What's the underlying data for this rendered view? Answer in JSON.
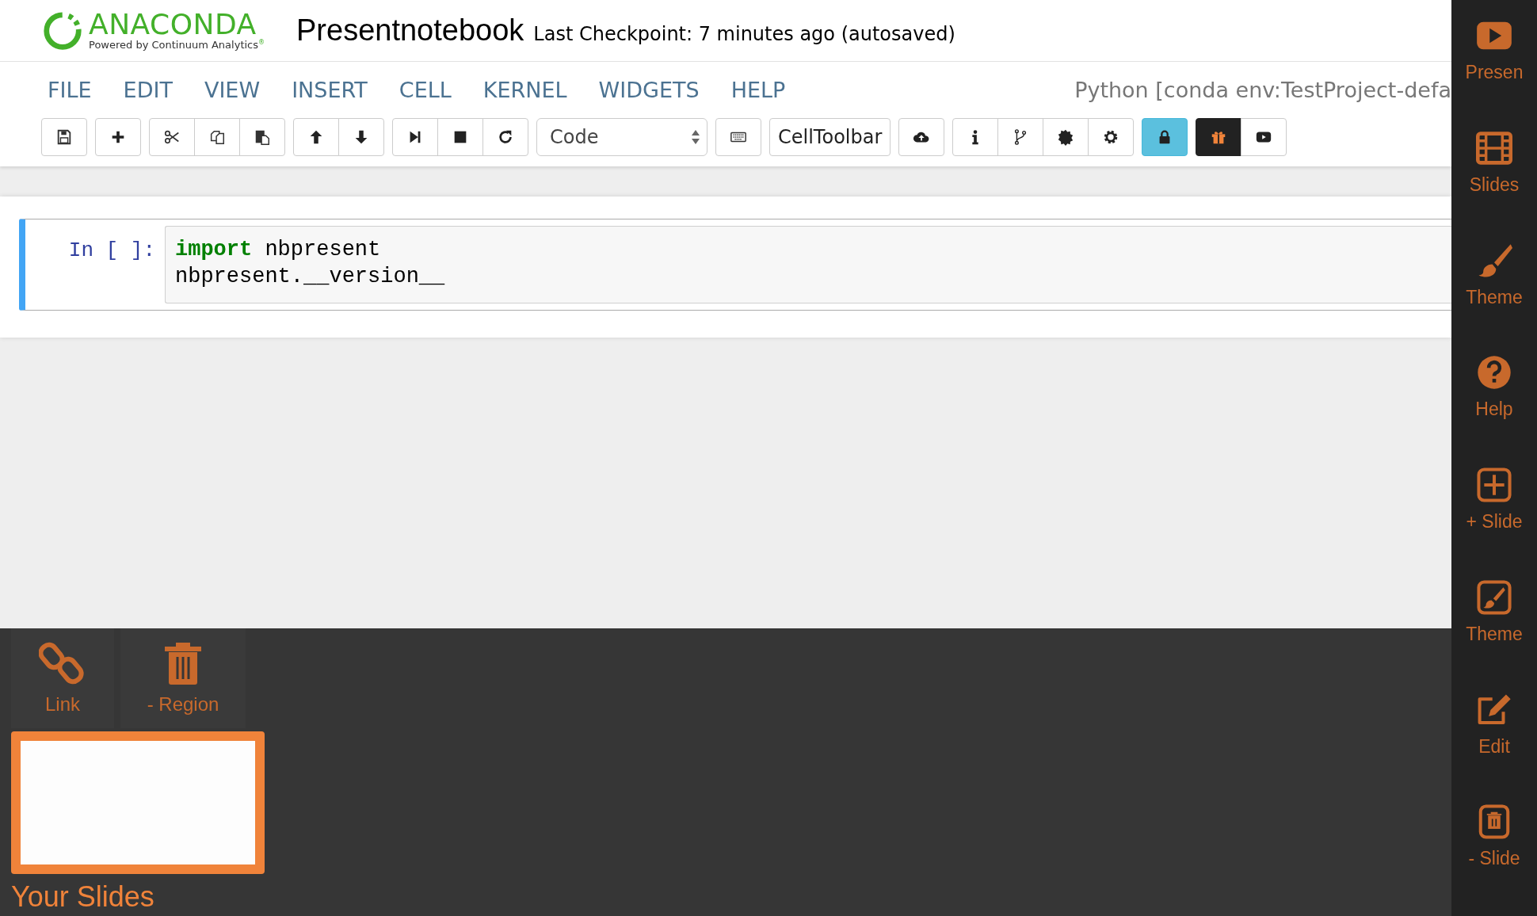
{
  "header": {
    "logo": {
      "name": "ANACONDA",
      "tagline": "Powered by Continuum Analytics$^{®}$"
    },
    "notebook_title": "Presentnotebook",
    "checkpoint": "Last Checkpoint: 7 minutes ago (autosaved)"
  },
  "menu": [
    "FILE",
    "EDIT",
    "VIEW",
    "INSERT",
    "CELL",
    "KERNEL",
    "WIDGETS",
    "HELP"
  ],
  "kernel": "Python [conda env:TestProject-defa",
  "toolbar": [
    [
      {
        "kind": "save",
        "on": false
      }
    ],
    [
      {
        "kind": "add",
        "on": false
      }
    ],
    [
      {
        "kind": "cut",
        "on": false
      },
      {
        "kind": "copy",
        "on": false
      },
      {
        "kind": "paste",
        "on": false
      }
    ],
    [
      {
        "kind": "up",
        "on": false
      },
      {
        "kind": "down",
        "on": false
      }
    ],
    [
      {
        "kind": "run",
        "on": false
      },
      {
        "kind": "stop",
        "on": false
      },
      {
        "kind": "restart",
        "on": false
      }
    ],
    [
      {
        "kind": "select",
        "label": "Code"
      }
    ],
    [
      {
        "kind": "keyboard",
        "on": false
      }
    ],
    [
      {
        "kind": "text",
        "label": "CellToolbar"
      }
    ],
    [
      {
        "kind": "upload",
        "on": false
      }
    ],
    [
      {
        "kind": "info",
        "on": false
      },
      {
        "kind": "branch",
        "on": false
      },
      {
        "kind": "badge",
        "on": false
      },
      {
        "kind": "gear",
        "on": false
      }
    ],
    [
      {
        "kind": "lock",
        "on": true
      }
    ],
    [
      {
        "kind": "gift",
        "on": true
      },
      {
        "kind": "play",
        "on": false
      }
    ]
  ],
  "cell": {
    "prompt": "In [ ]:",
    "selected": true,
    "lines": [
      "**import** nbpresent",
      "nbpresent.__version__"
    ]
  },
  "region_tools": [
    {
      "kind": "link",
      "label": "Link"
    },
    {
      "kind": "trash",
      "label": "- Region"
    }
  ],
  "slides": {
    "thumbnails": [
      {
        "selected": true
      }
    ],
    "title": "Your Slides"
  },
  "sidebar": [
    {
      "kind": "present",
      "label": "Presen"
    },
    {
      "kind": "slides",
      "label": "Slides"
    },
    {
      "kind": "brush",
      "label": "Theme"
    },
    {
      "kind": "help",
      "label": "Help"
    },
    {
      "kind": "plus-square",
      "label": "+ Slide"
    },
    {
      "kind": "brush-square",
      "label": "Theme"
    },
    {
      "kind": "edit",
      "label": "Edit"
    },
    {
      "kind": "trash-square",
      "label": "- Slide"
    }
  ]
}
